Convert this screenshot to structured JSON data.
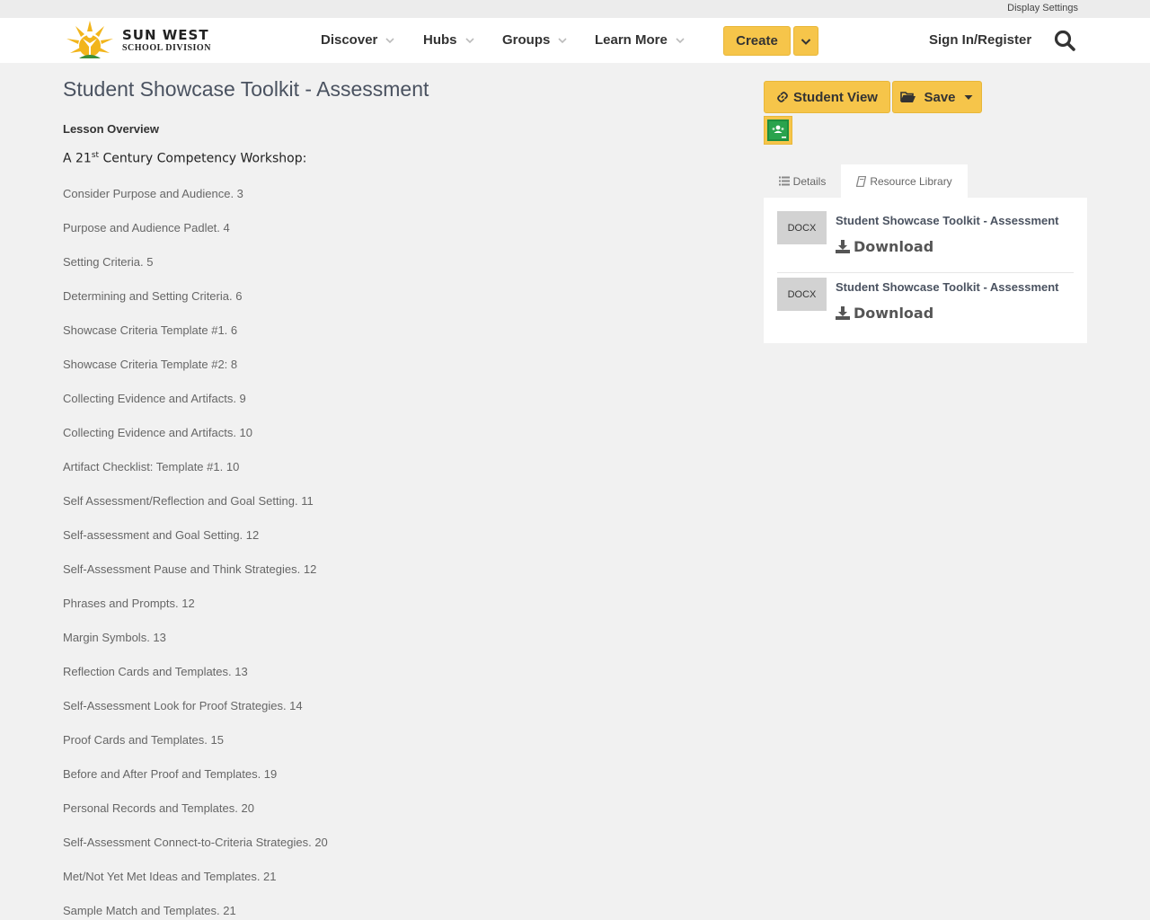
{
  "topbar": {
    "display_settings": "Display Settings"
  },
  "logo": {
    "line1": "SUN WEST",
    "line2": "SCHOOL DIVISION"
  },
  "nav": {
    "items": [
      {
        "label": "Discover"
      },
      {
        "label": "Hubs"
      },
      {
        "label": "Groups"
      },
      {
        "label": "Learn More"
      }
    ],
    "create_label": "Create",
    "signin_label": "Sign In/Register"
  },
  "page": {
    "title": "Student Showcase Toolkit - Assessment",
    "lesson_overview": "Lesson Overview",
    "workshop_prefix": "A 21",
    "workshop_sup": "st",
    "workshop_suffix": " Century Competency Workshop:",
    "toc": [
      "Consider Purpose and Audience. 3",
      "Purpose and Audience Padlet. 4",
      "Setting Criteria. 5",
      "Determining and Setting Criteria. 6",
      "Showcase Criteria Template #1. 6",
      "Showcase Criteria Template #2: 8",
      "Collecting Evidence and Artifacts. 9",
      "Collecting Evidence and Artifacts. 10",
      "Artifact Checklist: Template #1. 10",
      "Self Assessment/Reflection and Goal Setting. 11",
      "Self-assessment and Goal Setting. 12",
      "Self-Assessment Pause and Think Strategies. 12",
      "Phrases and Prompts. 12",
      "Margin Symbols. 13",
      "Reflection Cards and Templates. 13",
      "Self-Assessment Look for Proof Strategies. 14",
      "Proof Cards and Templates. 15",
      "Before and After Proof and Templates. 19",
      "Personal Records and Templates. 20",
      "Self-Assessment Connect-to-Criteria Strategies. 20",
      "Met/Not Yet Met Ideas and Templates. 21",
      "Sample Match and Templates. 21"
    ]
  },
  "sidebar": {
    "student_view_label": "Student View",
    "save_label": "Save",
    "tabs": {
      "details": "Details",
      "library": "Resource Library"
    },
    "resources": [
      {
        "type": "DOCX",
        "title": "Student Showcase Toolkit - Assessment",
        "download": "Download"
      },
      {
        "type": "DOCX",
        "title": "Student Showcase Toolkit - Assessment",
        "download": "Download"
      }
    ]
  },
  "colors": {
    "accent": "#f6c54a",
    "title": "#4a5260",
    "classroom_green": "#1e8e3e"
  }
}
